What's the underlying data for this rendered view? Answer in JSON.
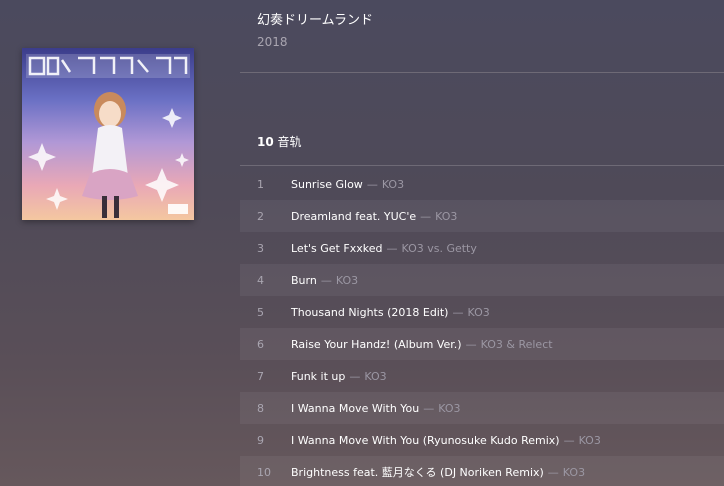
{
  "album": {
    "title": "幻奏ドリームランド",
    "year": "2018",
    "cover_icon": "album-cover-art"
  },
  "tracks_header": {
    "count": "10",
    "unit": "音轨"
  },
  "separator": "—",
  "tracks": [
    {
      "num": "1",
      "title": "Sunrise Glow",
      "artist": "KO3"
    },
    {
      "num": "2",
      "title": "Dreamland feat. YUC'e",
      "artist": "KO3"
    },
    {
      "num": "3",
      "title": "Let's Get Fxxked",
      "artist": "KO3 vs. Getty"
    },
    {
      "num": "4",
      "title": "Burn",
      "artist": "KO3"
    },
    {
      "num": "5",
      "title": "Thousand Nights (2018 Edit)",
      "artist": "KO3"
    },
    {
      "num": "6",
      "title": "Raise Your Handz! (Album Ver.)",
      "artist": "KO3 & Relect"
    },
    {
      "num": "7",
      "title": "Funk it up",
      "artist": "KO3"
    },
    {
      "num": "8",
      "title": "I Wanna Move With You",
      "artist": "KO3"
    },
    {
      "num": "9",
      "title": "I Wanna Move With You (Ryunosuke Kudo Remix)",
      "artist": "KO3"
    },
    {
      "num": "10",
      "title": "Brightness feat. 藍月なくる (DJ Noriken Remix)",
      "artist": "KO3"
    }
  ],
  "colors": {
    "background": "#4f4a58",
    "text_primary": "#ffffff",
    "text_secondary": "#9b97a3",
    "divider": "#6e6a76"
  }
}
